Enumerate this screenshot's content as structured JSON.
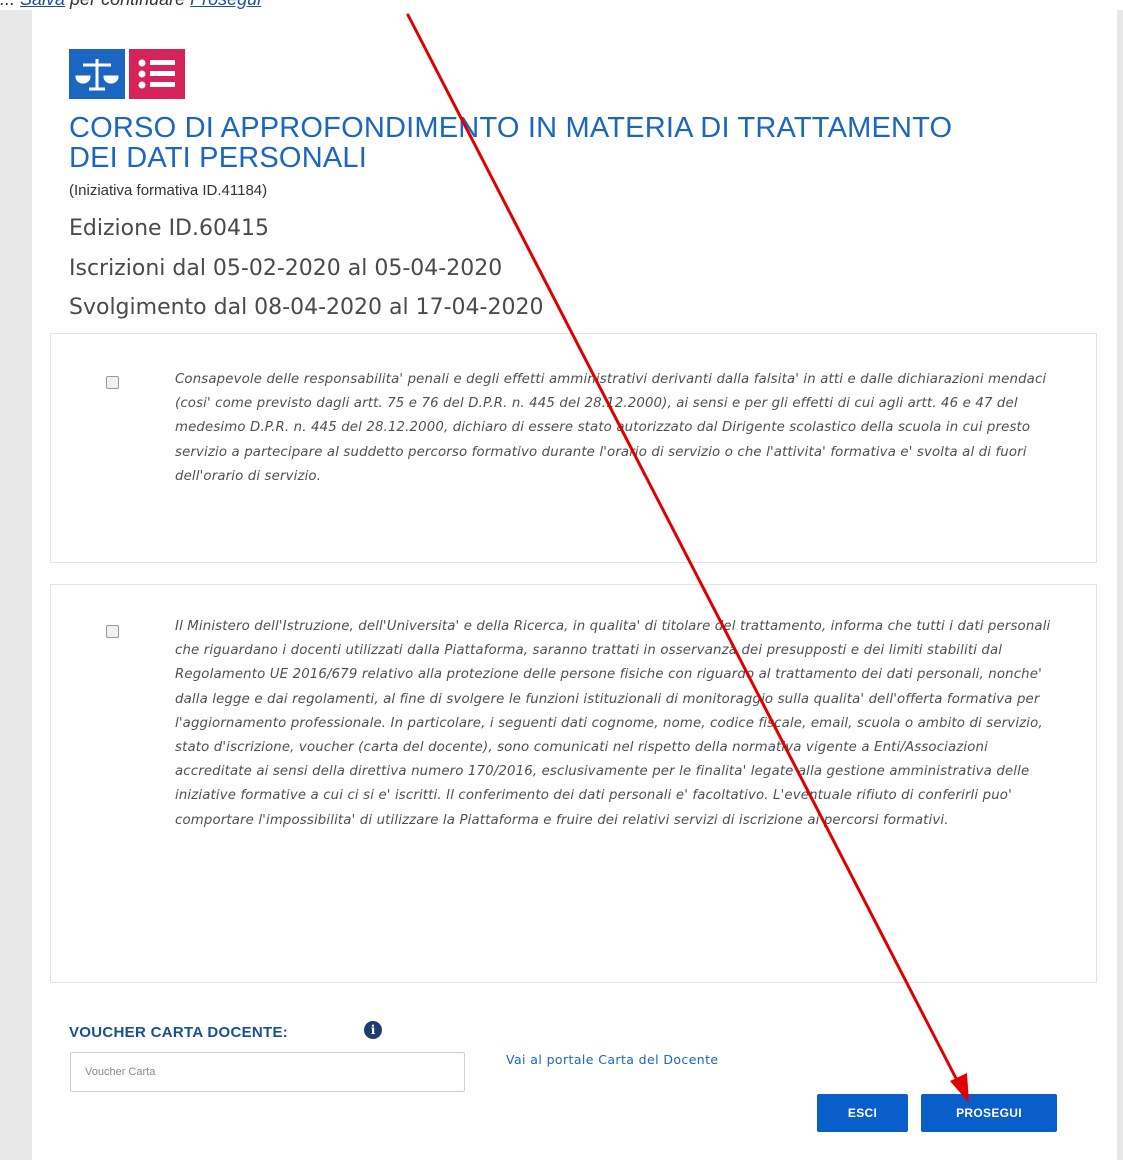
{
  "top_strip": {
    "prefix": "... ",
    "link_1": "Salva",
    "middle": " per continuare ",
    "link_2": "Prosegui"
  },
  "course": {
    "title": "CORSO DI APPROFONDIMENTO IN MATERIA DI TRATTAMENTO DEI DATI PERSONALI",
    "initiative": "(Iniziativa formativa ID.41184)",
    "edition": "Edizione ID.60415",
    "enrollment": "Iscrizioni dal 05-02-2020 al 05-04-2020",
    "schedule": "Svolgimento dal 08-04-2020 al 17-04-2020"
  },
  "declarations": [
    {
      "checked": false,
      "text": "Consapevole delle responsabilita' penali e degli effetti amministrativi derivanti dalla falsita' in atti e dalle dichiarazioni mendaci (cosi' come previsto dagli artt. 75 e 76 del D.P.R. n. 445 del 28.12.2000), ai sensi e per gli effetti di cui agli artt. 46 e 47 del medesimo D.P.R. n. 445 del 28.12.2000, dichiaro di essere stato autorizzato dal Dirigente scolastico della scuola in cui presto servizio a partecipare al suddetto percorso formativo durante l'orario di servizio o che l'attivita' formativa e' svolta al di fuori dell'orario di servizio."
    },
    {
      "checked": false,
      "text": "Il Ministero dell'Istruzione, dell'Universita' e della Ricerca, in qualita' di titolare del trattamento, informa che tutti i dati personali che riguardano i docenti utilizzati dalla Piattaforma, saranno trattati in osservanza dei presupposti e dei limiti stabiliti dal Regolamento UE 2016/679 relativo alla protezione delle persone fisiche con riguardo al trattamento dei dati personali, nonche' dalla legge e dai regolamenti, al fine di svolgere le funzioni istituzionali di monitoraggio sulla qualita' dell'offerta formativa per l'aggiornamento professionale. In particolare, i seguenti dati cognome, nome, codice fiscale, email, scuola o ambito di servizio, stato d'iscrizione, voucher (carta del docente), sono comunicati nel rispetto della normativa vigente a Enti/Associazioni accreditate ai sensi della direttiva numero 170/2016, esclusivamente per le finalita' legate alla gestione amministrativa delle iniziative formative a cui ci si e' iscritti. Il conferimento dei dati personali e' facoltativo. L'eventuale rifiuto di conferirli puo' comportare l'impossibilita' di utilizzare la Piattaforma e fruire dei relativi servizi di iscrizione ai percorsi formativi."
    }
  ],
  "voucher": {
    "label": "VOUCHER CARTA DOCENTE:",
    "info_icon": "info-icon",
    "placeholder": "Voucher Carta",
    "value": "",
    "portal_link": "Vai al portale Carta del Docente"
  },
  "actions": {
    "exit_label": "ESCI",
    "continue_label": "PROSEGUI"
  },
  "colors": {
    "title_blue": "#1a66c1",
    "button_blue": "#0a5ec9",
    "annotation_arrow": "#e00000",
    "logo_left": "#1a66c1",
    "logo_right": "#d6245a"
  }
}
